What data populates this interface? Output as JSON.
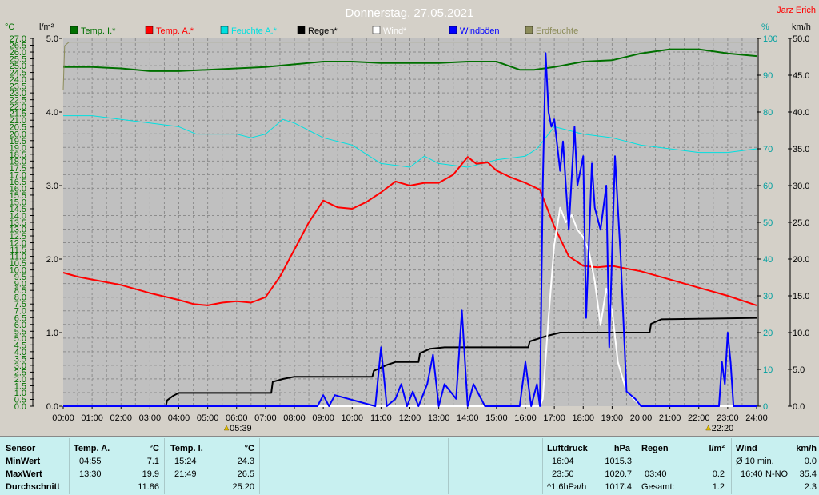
{
  "chart_data": {
    "type": "line",
    "title": "Donnerstag, 27.05.2021",
    "author": "Jarz Erich",
    "x_ticks": [
      "00:00",
      "01:00",
      "02:00",
      "03:00",
      "04:00",
      "05:00",
      "06:00",
      "07:00",
      "08:00",
      "09:00",
      "10:00",
      "11:00",
      "12:00",
      "13:00",
      "14:00",
      "15:00",
      "16:00",
      "17:00",
      "18:00",
      "19:00",
      "20:00",
      "21:00",
      "22:00",
      "23:00",
      "24:00"
    ],
    "axes": {
      "temp": {
        "unit": "°C",
        "range": [
          0.0,
          27.0
        ],
        "ticks": [
          "0.0",
          "0.5",
          "1.0",
          "1.5",
          "2.0",
          "2.5",
          "3.0",
          "3.5",
          "4.0",
          "4.5",
          "5.0",
          "5.5",
          "6.0",
          "6.5",
          "7.0",
          "7.5",
          "8.0",
          "8.5",
          "9.0",
          "9.5",
          "10.0",
          "10.5",
          "11.0",
          "11.5",
          "12.0",
          "12.5",
          "13.0",
          "13.5",
          "14.0",
          "14.5",
          "15.0",
          "15.5",
          "16.0",
          "16.5",
          "17.0",
          "17.5",
          "18.0",
          "18.5",
          "19.0",
          "19.5",
          "20.0",
          "20.5",
          "21.0",
          "21.5",
          "22.0",
          "22.5",
          "23.0",
          "23.5",
          "24.0",
          "24.5",
          "25.0",
          "25.5",
          "26.0",
          "26.5",
          "27.0"
        ]
      },
      "rain": {
        "unit": "l/m²",
        "range": [
          0.0,
          5.0
        ],
        "ticks": [
          "0.0",
          "1.0",
          "2.0",
          "3.0",
          "4.0",
          "5.0"
        ]
      },
      "humidity": {
        "unit": "%",
        "range": [
          0,
          100
        ],
        "ticks": [
          "0",
          "10",
          "20",
          "30",
          "40",
          "50",
          "60",
          "70",
          "80",
          "90",
          "100"
        ]
      },
      "wind": {
        "unit": "km/h",
        "range": [
          0.0,
          50.0
        ],
        "ticks": [
          "0.0",
          "5.0",
          "10.0",
          "15.0",
          "20.0",
          "25.0",
          "30.0",
          "35.0",
          "40.0",
          "45.0",
          "50.0"
        ]
      }
    },
    "legend": [
      {
        "label": "Temp. I.*",
        "color": "#007000"
      },
      {
        "label": "Temp. A.*",
        "color": "#ff0000"
      },
      {
        "label": "Feuchte A.*",
        "color": "#00e0e0"
      },
      {
        "label": "Regen*",
        "color": "#000000"
      },
      {
        "label": "Wind*",
        "color": "#ffffff"
      },
      {
        "label": "Windböen",
        "color": "#0000ff"
      },
      {
        "label": "Erdfeuchte",
        "color": "#8c8c5a"
      }
    ],
    "sun_markers": [
      {
        "label": "05:39",
        "x": 5.65
      },
      {
        "label": "22:20",
        "x": 22.33
      }
    ],
    "series": [
      {
        "name": "Temp. I.*",
        "axis": "temp",
        "color": "#007000",
        "x": [
          0,
          1,
          2,
          3,
          4,
          5,
          6,
          7,
          8,
          9,
          10,
          11,
          12,
          13,
          14,
          15,
          15.8,
          16.3,
          17,
          18,
          19,
          20,
          21,
          22,
          23,
          24
        ],
        "y": [
          24.9,
          24.9,
          24.8,
          24.6,
          24.6,
          24.7,
          24.8,
          24.9,
          25.1,
          25.3,
          25.3,
          25.2,
          25.2,
          25.2,
          25.3,
          25.3,
          24.7,
          24.7,
          24.9,
          25.3,
          25.4,
          25.9,
          26.2,
          26.2,
          25.9,
          25.7
        ]
      },
      {
        "name": "Feuchte A.*",
        "axis": "humidity",
        "color": "#00e0e0",
        "x": [
          0,
          1,
          2,
          3,
          4,
          4.6,
          5,
          6,
          6.5,
          7,
          7.6,
          8,
          9,
          10,
          11,
          12,
          12.5,
          13,
          14,
          15,
          16,
          16.4,
          17,
          18,
          19,
          20,
          21,
          22,
          23,
          24
        ],
        "y": [
          79,
          79,
          78,
          77,
          76,
          74,
          74,
          74,
          73,
          74,
          78,
          77,
          73,
          71,
          66,
          65,
          68,
          66,
          65,
          67,
          68,
          70,
          76,
          74,
          73,
          71,
          70,
          69,
          69,
          70
        ]
      },
      {
        "name": "Temp. A.*",
        "axis": "temp",
        "color": "#ff0000",
        "x": [
          0,
          0.5,
          1,
          2,
          3,
          4,
          4.5,
          5,
          5.5,
          6,
          6.5,
          7,
          7.5,
          8,
          8.5,
          9,
          9.5,
          10,
          10.5,
          11,
          11.5,
          12,
          12.5,
          13,
          13.5,
          14,
          14.3,
          14.7,
          15,
          15.5,
          16,
          16.5,
          17,
          17.5,
          18,
          18.5,
          19,
          20,
          21,
          22,
          23,
          24
        ],
        "y": [
          9.8,
          9.5,
          9.3,
          8.9,
          8.3,
          7.8,
          7.5,
          7.4,
          7.6,
          7.7,
          7.6,
          8.0,
          9.5,
          11.5,
          13.5,
          15.1,
          14.6,
          14.5,
          15.0,
          15.7,
          16.5,
          16.2,
          16.4,
          16.4,
          17.0,
          18.3,
          17.8,
          17.9,
          17.3,
          16.8,
          16.4,
          15.9,
          13.2,
          11.0,
          10.3,
          10.2,
          10.3,
          9.9,
          9.3,
          8.7,
          8.1,
          7.4
        ]
      },
      {
        "name": "Regen*",
        "axis": "rain",
        "color": "#000000",
        "x": [
          0,
          3.55,
          3.6,
          3.8,
          4.0,
          7.2,
          7.25,
          7.6,
          8.0,
          10.7,
          10.75,
          11.2,
          11.5,
          12.3,
          12.35,
          12.7,
          13.2,
          16.1,
          16.15,
          16.7,
          17.2,
          20.3,
          20.35,
          20.7,
          24
        ],
        "y": [
          0,
          0,
          0.08,
          0.14,
          0.18,
          0.18,
          0.33,
          0.37,
          0.4,
          0.4,
          0.48,
          0.56,
          0.6,
          0.6,
          0.72,
          0.78,
          0.8,
          0.8,
          0.88,
          0.95,
          1.0,
          1.0,
          1.12,
          1.18,
          1.2
        ]
      },
      {
        "name": "Wind*",
        "axis": "wind",
        "color": "#ffffff",
        "x": [
          0,
          16.5,
          16.6,
          16.8,
          17.0,
          17.2,
          17.4,
          17.6,
          17.8,
          18.0,
          18.2,
          18.4,
          18.6,
          18.8,
          19.0,
          19.2,
          19.5,
          20.0,
          24
        ],
        "y": [
          0,
          0,
          1,
          12,
          22,
          27,
          25,
          26,
          24,
          23,
          21,
          17,
          11,
          16,
          13,
          6,
          2,
          0,
          0
        ]
      },
      {
        "name": "Windböen",
        "axis": "wind",
        "color": "#0000ff",
        "x": [
          0,
          8.8,
          9.0,
          9.2,
          9.4,
          10.8,
          11.0,
          11.2,
          11.5,
          11.7,
          11.9,
          12.1,
          12.3,
          12.6,
          12.8,
          13.0,
          13.2,
          13.6,
          13.8,
          14.0,
          14.2,
          14.6,
          15.8,
          16.0,
          16.2,
          16.4,
          16.5,
          16.6,
          16.7,
          16.8,
          16.9,
          17.0,
          17.2,
          17.3,
          17.5,
          17.7,
          17.8,
          18.0,
          18.1,
          18.3,
          18.4,
          18.6,
          18.8,
          18.9,
          19.1,
          19.3,
          19.5,
          19.8,
          20.0,
          22.7,
          22.8,
          22.9,
          23.0,
          23.1,
          23.2,
          24
        ],
        "y": [
          0,
          0,
          1.5,
          0,
          1.5,
          0,
          8,
          0,
          1,
          3,
          0,
          2,
          0,
          3,
          7,
          0,
          3,
          1,
          13,
          0,
          3,
          0,
          0,
          6,
          0,
          3,
          0,
          30,
          48,
          40,
          38,
          39,
          32,
          36,
          24,
          38,
          30,
          34,
          12,
          33,
          27,
          24,
          30,
          8,
          34,
          20,
          2,
          1,
          0,
          0,
          6,
          3,
          10,
          6,
          0,
          0
        ]
      },
      {
        "name": "Erdfeuchte",
        "axis": "humidity",
        "color": "#8c8c5a",
        "x": [
          0,
          0.05,
          0.2,
          1,
          2,
          3,
          4,
          5,
          6,
          7,
          8,
          9,
          10,
          11,
          12,
          13,
          14,
          15,
          16,
          17,
          18,
          19,
          20,
          21,
          22,
          23,
          24
        ],
        "y": [
          86,
          98,
          99,
          99,
          99,
          99,
          99,
          99,
          99,
          99,
          99,
          99,
          99,
          99,
          99,
          99,
          99,
          99,
          99,
          99,
          99,
          99,
          99,
          99,
          99,
          99,
          99
        ]
      }
    ]
  },
  "table": {
    "sensor": {
      "header": "Sensor",
      "rows": [
        "MinWert",
        "MaxWert",
        "Durchschnitt"
      ]
    },
    "temp_a": {
      "header": "Temp. A.",
      "unit": "°C",
      "times": [
        "04:55",
        "13:30",
        ""
      ],
      "values": [
        "7.1",
        "19.9",
        "11.86"
      ]
    },
    "temp_i": {
      "header": "Temp. I.",
      "unit": "°C",
      "times": [
        "15:24",
        "21:49",
        ""
      ],
      "values": [
        "24.3",
        "26.5",
        "25.20"
      ]
    },
    "luftdruck": {
      "header": "Luftdruck",
      "unit": "hPa",
      "times": [
        "16:04",
        "23:50",
        "^1.6hPa/h"
      ],
      "values": [
        "1015.3",
        "1020.7",
        "1017.4"
      ]
    },
    "regen": {
      "header": "Regen",
      "unit": "l/m²",
      "times": [
        "",
        "03:40",
        "Gesamt:"
      ],
      "values": [
        "",
        "0.2",
        "1.2"
      ]
    },
    "wind": {
      "header": "Wind",
      "unit": "km/h",
      "times": [
        "Ø 10 min.",
        "16:40",
        ""
      ],
      "dir": "N-NO",
      "values": [
        "0.0",
        "35.4",
        "2.3"
      ]
    }
  }
}
